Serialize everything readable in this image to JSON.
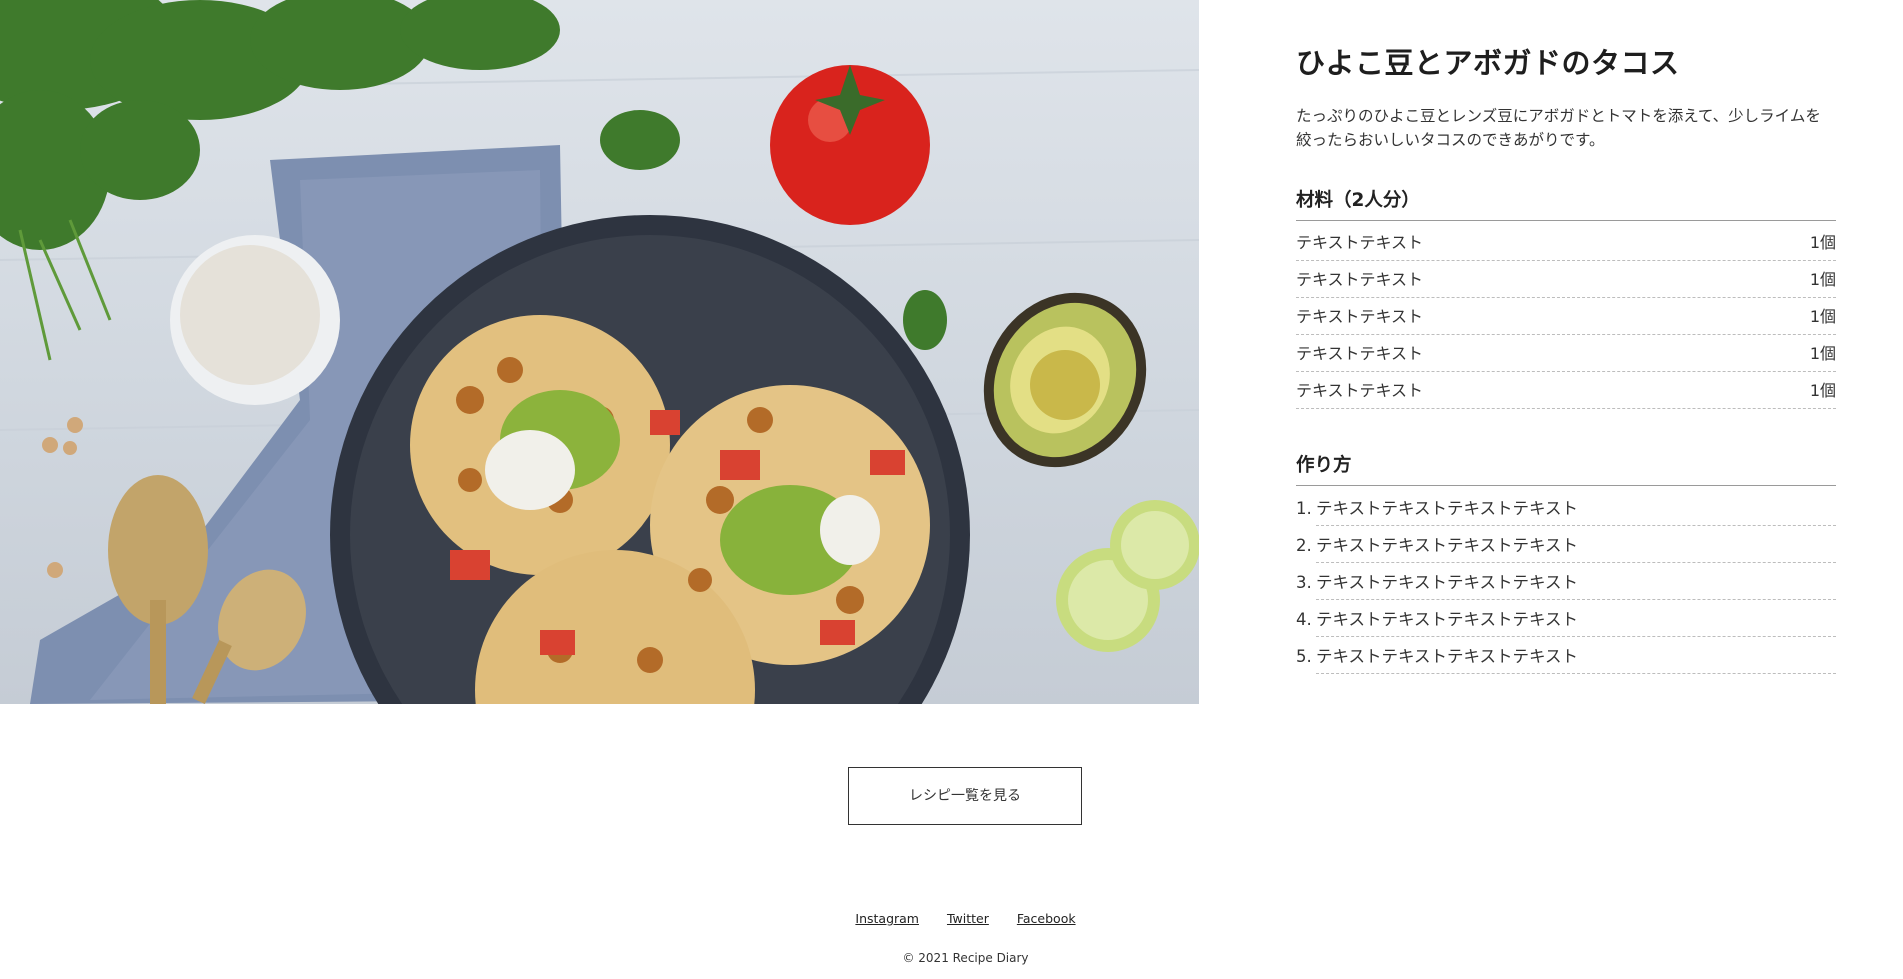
{
  "recipe": {
    "title": "ひよこ豆とアボガドのタコス",
    "description": "たっぷりのひよこ豆とレンズ豆にアボガドとトマトを添えて、少しライムを絞ったらおいしいタコスのできあがりです。",
    "ingredients_heading": "材料（2人分）",
    "ingredients": [
      {
        "name": "テキストテキスト",
        "amount": "1個"
      },
      {
        "name": "テキストテキスト",
        "amount": "1個"
      },
      {
        "name": "テキストテキスト",
        "amount": "1個"
      },
      {
        "name": "テキストテキスト",
        "amount": "1個"
      },
      {
        "name": "テキストテキスト",
        "amount": "1個"
      }
    ],
    "steps_heading": "作り方",
    "steps": [
      {
        "num": "1.",
        "text": "テキストテキストテキストテキスト"
      },
      {
        "num": "2.",
        "text": "テキストテキストテキストテキスト"
      },
      {
        "num": "3.",
        "text": "テキストテキストテキストテキスト"
      },
      {
        "num": "4.",
        "text": "テキストテキストテキストテキスト"
      },
      {
        "num": "5.",
        "text": "テキストテキストテキストテキスト"
      }
    ]
  },
  "actions": {
    "more_recipes_label": "レシピ一覧を見る"
  },
  "footer": {
    "links": [
      "Instagram",
      "Twitter",
      "Facebook"
    ],
    "copyright": "© 2021 Recipe Diary"
  }
}
